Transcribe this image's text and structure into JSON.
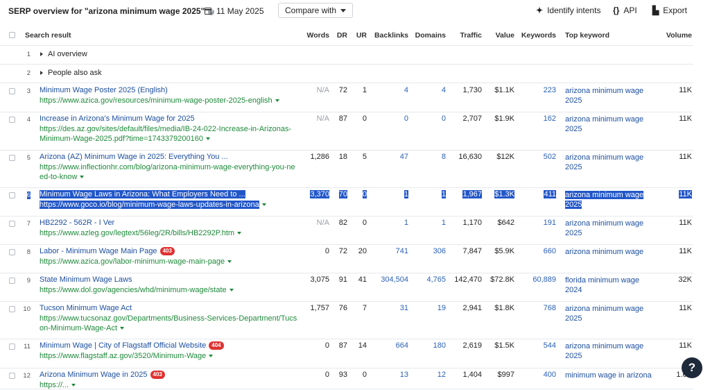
{
  "header": {
    "title": "SERP overview for \"arizona minimum wage 2025\"",
    "date": "11 May 2025",
    "compare_label": "Compare with",
    "identify_label": "Identify intents",
    "identify_icon": "sparkle-icon",
    "api_label": "API",
    "api_icon": "{}",
    "export_label": "Export",
    "export_icon": "export-file-icon"
  },
  "columns": {
    "search_result": "Search result",
    "words": "Words",
    "dr": "DR",
    "ur": "UR",
    "backlinks": "Backlinks",
    "domains": "Domains",
    "traffic": "Traffic",
    "value": "Value",
    "keywords": "Keywords",
    "top_keyword": "Top keyword",
    "volume": "Volume"
  },
  "groups": [
    {
      "rank": "1",
      "label": "AI overview"
    },
    {
      "rank": "2",
      "label": "People also ask"
    }
  ],
  "rows": [
    {
      "rank": "3",
      "title": "Minimum Wage Poster 2025 (English)",
      "badge": "",
      "url": "https://www.azica.gov/resources/minimum-wage-poster-2025-english",
      "words": "N/A",
      "dr": "72",
      "ur": "1",
      "backlinks": "4",
      "domains": "4",
      "traffic": "1,730",
      "value": "$1.1K",
      "keywords": "223",
      "top_keyword": "arizona minimum wage 2025",
      "volume": "11K"
    },
    {
      "rank": "4",
      "title": "Increase in Arizona's Minimum Wage for 2025",
      "badge": "",
      "url": "https://des.az.gov/sites/default/files/media/IB-24-022-Increase-in-Arizonas-Minimum-Wage-2025.pdf?time=1743379200160",
      "words": "N/A",
      "dr": "87",
      "ur": "0",
      "backlinks": "0",
      "domains": "0",
      "traffic": "2,707",
      "value": "$1.9K",
      "keywords": "162",
      "top_keyword": "arizona minimum wage 2025",
      "volume": "11K"
    },
    {
      "rank": "5",
      "title": "Arizona (AZ) Minimum Wage in 2025: Everything You ...",
      "badge": "",
      "url": "https://www.inflectionhr.com/blog/arizona-minimum-wage-everything-you-need-to-know",
      "words": "1,286",
      "dr": "18",
      "ur": "5",
      "backlinks": "47",
      "domains": "8",
      "traffic": "16,630",
      "value": "$12K",
      "keywords": "502",
      "top_keyword": "arizona minimum wage 2025",
      "volume": "11K"
    },
    {
      "rank": "6",
      "title": "Minimum Wage Laws in Arizona: What Employers Need to ...",
      "badge": "",
      "url": "https://www.goco.io/blog/minimum-wage-laws-updates-in-arizona",
      "words": "3,370",
      "dr": "70",
      "ur": "0",
      "backlinks": "1",
      "domains": "1",
      "traffic": "1,967",
      "value": "$1.3K",
      "keywords": "411",
      "top_keyword": "arizona minimum wage 2025",
      "volume": "11K",
      "selected": true
    },
    {
      "rank": "7",
      "title": "HB2292 - 562R - I Ver",
      "badge": "",
      "url": "https://www.azleg.gov/legtext/56leg/2R/bills/HB2292P.htm",
      "words": "N/A",
      "dr": "82",
      "ur": "0",
      "backlinks": "1",
      "domains": "1",
      "traffic": "1,170",
      "value": "$642",
      "keywords": "191",
      "top_keyword": "arizona minimum wage 2025",
      "volume": "11K"
    },
    {
      "rank": "8",
      "title": "Labor - Minimum Wage Main Page",
      "badge": "403",
      "url": "https://www.azica.gov/labor-minimum-wage-main-page",
      "words": "0",
      "dr": "72",
      "ur": "20",
      "backlinks": "741",
      "domains": "306",
      "traffic": "7,847",
      "value": "$5.9K",
      "keywords": "660",
      "top_keyword": "arizona minimum wage",
      "volume": "11K"
    },
    {
      "rank": "9",
      "title": "State Minimum Wage Laws",
      "badge": "",
      "url": "https://www.dol.gov/agencies/whd/minimum-wage/state",
      "words": "3,075",
      "dr": "91",
      "ur": "41",
      "backlinks": "304,504",
      "domains": "4,765",
      "traffic": "142,470",
      "value": "$72.8K",
      "keywords": "60,889",
      "top_keyword": "florida minimum wage 2024",
      "volume": "32K"
    },
    {
      "rank": "10",
      "title": "Tucson Minimum Wage Act",
      "badge": "",
      "url": "https://www.tucsonaz.gov/Departments/Business-Services-Department/Tucson-Minimum-Wage-Act",
      "words": "1,757",
      "dr": "76",
      "ur": "7",
      "backlinks": "31",
      "domains": "19",
      "traffic": "2,941",
      "value": "$1.8K",
      "keywords": "768",
      "top_keyword": "arizona minimum wage 2025",
      "volume": "11K"
    },
    {
      "rank": "11",
      "title": "Minimum Wage | City of Flagstaff Official Website",
      "badge": "404",
      "url": "https://www.flagstaff.az.gov/3520/Minimum-Wage",
      "words": "0",
      "dr": "87",
      "ur": "14",
      "backlinks": "664",
      "domains": "180",
      "traffic": "2,619",
      "value": "$1.5K",
      "keywords": "544",
      "top_keyword": "arizona minimum wage 2025",
      "volume": "11K"
    },
    {
      "rank": "12",
      "title": "Arizona Minimum Wage in 2025",
      "badge": "403",
      "url": "https://...",
      "words": "0",
      "dr": "93",
      "ur": "0",
      "backlinks": "13",
      "domains": "12",
      "traffic": "1,404",
      "value": "$997",
      "keywords": "400",
      "top_keyword": "minimum wage in arizona",
      "volume": "1.6K"
    }
  ],
  "help_button": "?"
}
